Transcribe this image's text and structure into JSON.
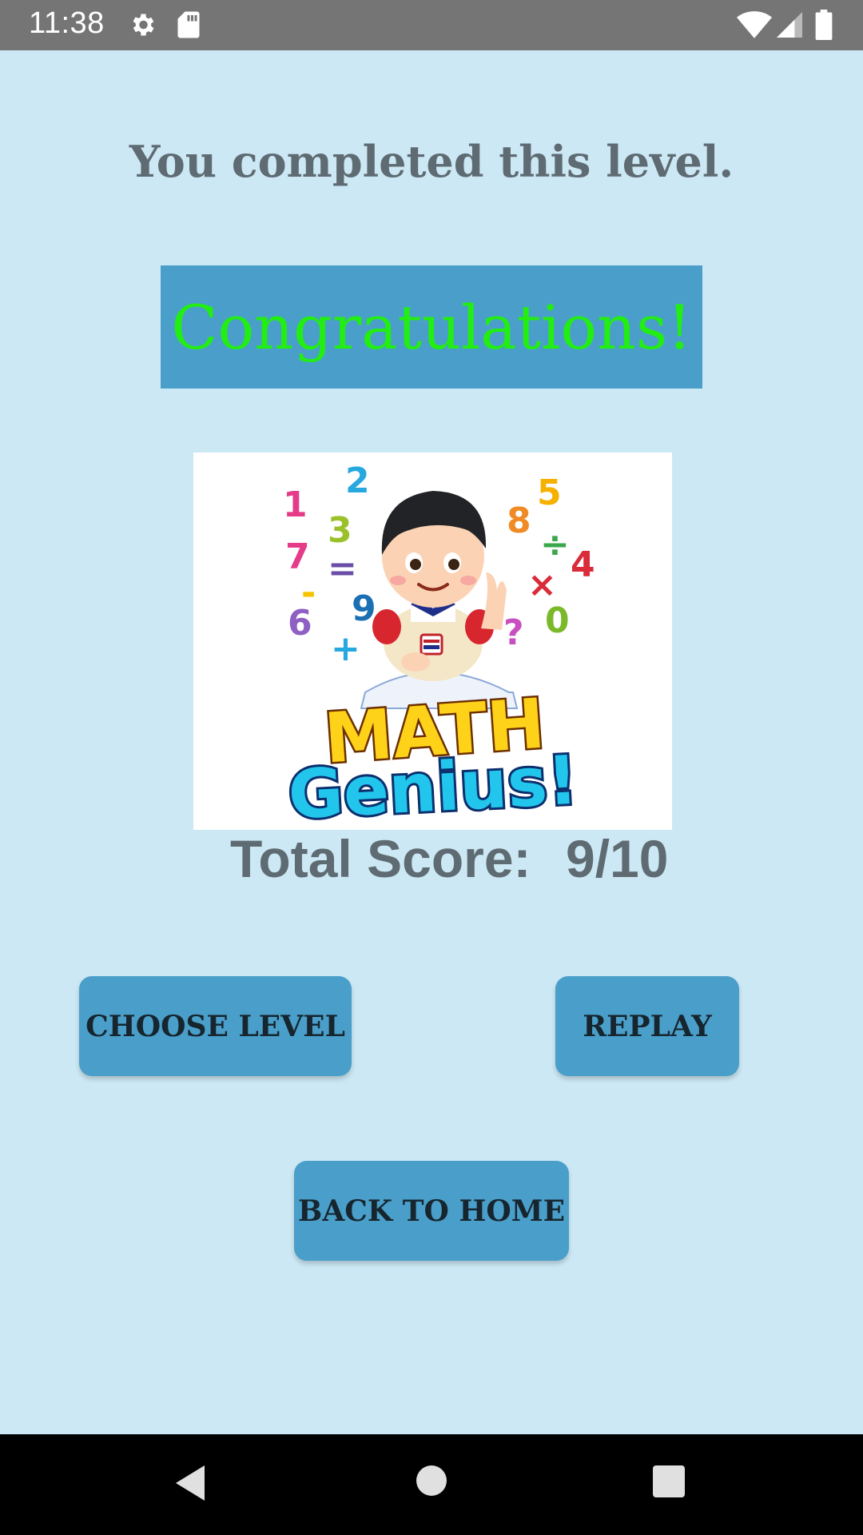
{
  "status_bar": {
    "time": "11:38",
    "icons": [
      "gear-icon",
      "sd-card-icon",
      "wifi-icon",
      "signal-icon",
      "battery-icon"
    ]
  },
  "screen": {
    "completed_message": "You completed this level.",
    "congrats_message": "Congratulations!",
    "logo": {
      "line1": "MATH",
      "line2": "Genius!",
      "floating_symbols": [
        "1",
        "2",
        "3",
        "5",
        "7",
        "8",
        "=",
        "÷",
        "4",
        "×",
        "6",
        "9",
        "?",
        "0",
        "+",
        "-"
      ]
    },
    "score_label": "Total Score:",
    "score_value": "9/10"
  },
  "buttons": {
    "choose_level": "CHOOSE LEVEL",
    "replay": "REPLAY",
    "back_to_home": "BACK TO HOME"
  },
  "nav_bar": {
    "icons": [
      "back-icon",
      "home-icon",
      "recents-icon"
    ]
  },
  "colors": {
    "background": "#cce8f4",
    "button": "#4a9fca",
    "congrats_text": "#22ee11",
    "muted_text": "#5f6b72"
  }
}
